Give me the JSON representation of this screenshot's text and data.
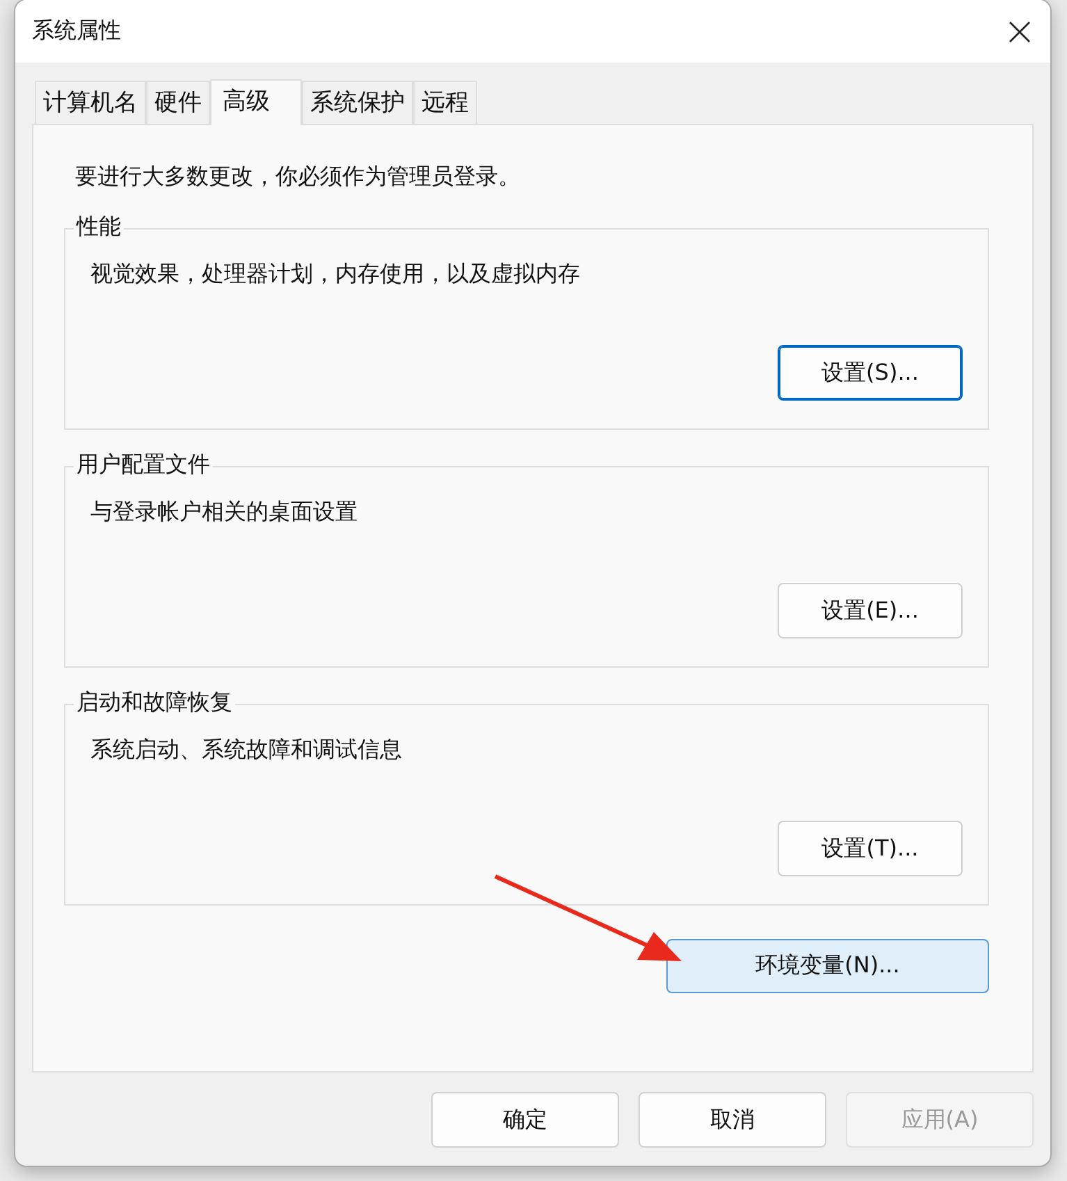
{
  "window": {
    "title": "系统属性"
  },
  "tabs": [
    {
      "label": "计算机名",
      "selected": false
    },
    {
      "label": "硬件",
      "selected": false
    },
    {
      "label": "高级",
      "selected": true
    },
    {
      "label": "系统保护",
      "selected": false
    },
    {
      "label": "远程",
      "selected": false
    }
  ],
  "notice": "要进行大多数更改，你必须作为管理员登录。",
  "groups": [
    {
      "title": "性能",
      "description": "视觉效果，处理器计划，内存使用，以及虚拟内存",
      "button": {
        "label": "设置(S)...",
        "focused": true
      }
    },
    {
      "title": "用户配置文件",
      "description": "与登录帐户相关的桌面设置",
      "button": {
        "label": "设置(E)...",
        "focused": false
      }
    },
    {
      "title": "启动和故障恢复",
      "description": "系统启动、系统故障和调试信息",
      "button": {
        "label": "设置(T)...",
        "focused": false
      }
    }
  ],
  "env_button": {
    "label": "环境变量(N)...",
    "highlighted": true
  },
  "buttons": [
    {
      "label": "确定",
      "disabled": false
    },
    {
      "label": "取消",
      "disabled": false
    },
    {
      "label": "应用(A)",
      "disabled": true
    }
  ]
}
